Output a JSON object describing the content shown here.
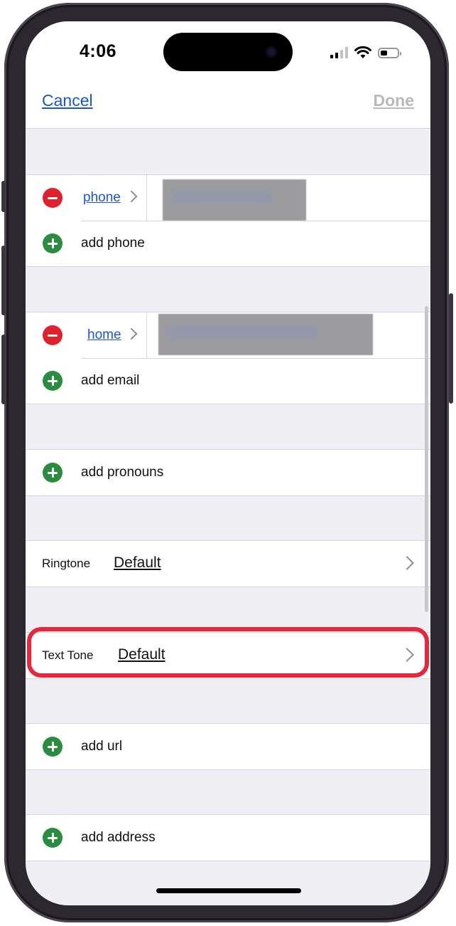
{
  "status_bar": {
    "time": "4:06"
  },
  "nav": {
    "cancel_label": "Cancel",
    "done_label": "Done"
  },
  "phone": {
    "type_label": "phone",
    "add_label": "add phone"
  },
  "email": {
    "type_label": "home",
    "add_label": "add email"
  },
  "pronouns": {
    "add_label": "add pronouns"
  },
  "ringtone": {
    "title": "Ringtone",
    "value": "Default"
  },
  "text_tone": {
    "title": "Text Tone",
    "value": "Default"
  },
  "url": {
    "add_label": "add url"
  },
  "address": {
    "add_label": "add address"
  },
  "colors": {
    "accent": "#1a57d6",
    "delete": "#e0202c",
    "add": "#2a8c3e",
    "highlight": "#e8263c"
  }
}
